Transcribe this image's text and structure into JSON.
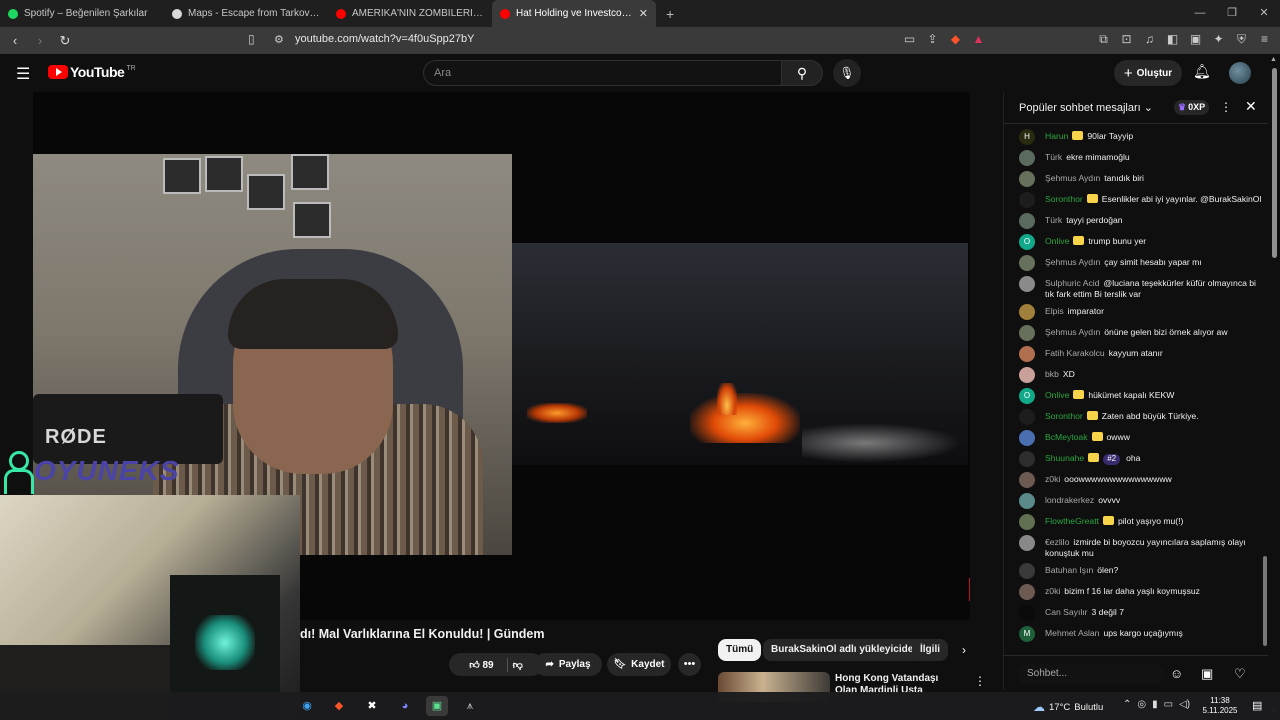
{
  "browser": {
    "tabs": [
      {
        "title": "Spotify – Beğenilen Şarkılar",
        "favicon_color": "#1ed760",
        "active": false
      },
      {
        "title": "Maps - Escape from Tarkov - Tarkov...",
        "favicon_color": "#d9d9d9",
        "active": false
      },
      {
        "title": "AMERİKA'NIN ZOMBİLERİ (BÖYLE Bİ...",
        "favicon_color": "#ff0000",
        "active": false
      },
      {
        "title": "Hat Holding ve Investco Hold...",
        "favicon_color": "#ff0000",
        "active": true
      }
    ],
    "url": "youtube.com/watch?v=4f0uSpp27bY"
  },
  "masthead": {
    "logo_text": "YouTube",
    "country_code": "TR",
    "search_placeholder": "Ara",
    "create_label": "Oluştur"
  },
  "video": {
    "title": "dı! Mal Varlıklarına El Konuldu! | Gündem",
    "like_count": "89",
    "share_label": "Paylaş",
    "save_label": "Kaydet",
    "mic_brand": "RØDE",
    "overlay_logo": "OYUNEKS"
  },
  "related": {
    "chips": [
      "Tümü",
      "BurakSakinOl adlı yükleyiciden",
      "İlgili"
    ],
    "first_video_title": "Hong Kong Vatandaşı Olan Mardinli Usta Anlatıyor ve..."
  },
  "chat": {
    "header_title": "Popüler sohbet mesajları",
    "xp_label": "0XP",
    "input_placeholder": "Sohbet...",
    "messages": [
      {
        "author": "Harun",
        "text": "90lar Tayyip",
        "member": true,
        "avatar_color": "#2a2a10",
        "avatar_letter": "H"
      },
      {
        "author": "Türk",
        "text": "ekre mimamoğlu",
        "member": false,
        "avatar_color": "#5b6a5f",
        "avatar_letter": ""
      },
      {
        "author": "Şehmus Aydın",
        "text": "tanıdık biri",
        "member": false,
        "avatar_color": "#66705a",
        "avatar_letter": ""
      },
      {
        "author": "Soronthor",
        "text": "Esenlikler abi iyi yayınlar. @BurakSakinOl",
        "member": true,
        "avatar_color": "#1d1d1d",
        "avatar_letter": ""
      },
      {
        "author": "Türk",
        "text": "tayyi perdoğan",
        "member": false,
        "avatar_color": "#5b6a5f",
        "avatar_letter": ""
      },
      {
        "author": "Onlive",
        "text": "trump bunu yer",
        "member": true,
        "avatar_color": "#12a88a",
        "avatar_letter": "O"
      },
      {
        "author": "Şehmus Aydın",
        "text": "çay simit hesabı yapar mı",
        "member": false,
        "avatar_color": "#66705a",
        "avatar_letter": ""
      },
      {
        "author": "Sulphuric Acid",
        "text": "@luciana teşekkürler küfür olmayınca bi tık fark ettim Bi terslik var",
        "member": false,
        "avatar_color": "#8a8a8a",
        "avatar_letter": ""
      },
      {
        "author": "Elpis",
        "text": "imparator",
        "member": false,
        "avatar_color": "#a0803a",
        "avatar_letter": ""
      },
      {
        "author": "Şehmus Aydın",
        "text": "önüne gelen bizi örnek alıyor aw",
        "member": false,
        "avatar_color": "#66705a",
        "avatar_letter": ""
      },
      {
        "author": "Fatih Karakolcu",
        "text": "kayyum atanır",
        "member": false,
        "avatar_color": "#b07050",
        "avatar_letter": ""
      },
      {
        "author": "bkb",
        "text": "XD",
        "member": false,
        "avatar_color": "#c9a19a",
        "avatar_letter": ""
      },
      {
        "author": "Onlive",
        "text": "hükümet kapalı KEKW",
        "member": true,
        "avatar_color": "#12a88a",
        "avatar_letter": "O"
      },
      {
        "author": "Soronthor",
        "text": "Zaten abd büyük Türkiye.",
        "member": true,
        "avatar_color": "#1d1d1d",
        "avatar_letter": ""
      },
      {
        "author": "BcMeytoak",
        "text": "owww",
        "member": true,
        "avatar_color": "#4a6fb0",
        "avatar_letter": ""
      },
      {
        "author": "Shuunahe",
        "text": "oha",
        "member": true,
        "avatar_color": "#2d2d2d",
        "avatar_letter": "",
        "rank": "#2"
      },
      {
        "author": "z0ki",
        "text": "ooowwwwwwwwwwwwwww",
        "member": false,
        "avatar_color": "#6d5a50",
        "avatar_letter": ""
      },
      {
        "author": "londrakerkez",
        "text": "ovvvv",
        "member": false,
        "avatar_color": "#5a8a8a",
        "avatar_letter": ""
      },
      {
        "author": "FlowtheGreatt",
        "text": "pilot yaşıyo mu(!)",
        "member": true,
        "avatar_color": "#607050",
        "avatar_letter": ""
      },
      {
        "author": "€ezlilo",
        "text": "izmirde bi boyozcu yayıncılara saplamış olayı konuştuk mu",
        "member": false,
        "avatar_color": "#888888",
        "avatar_letter": ""
      },
      {
        "author": "Batuhan Işın",
        "text": "ölen?",
        "member": false,
        "avatar_color": "#3a3a3a",
        "avatar_letter": ""
      },
      {
        "author": "z0ki",
        "text": "bizim f 16 lar daha yaşlı koymuşsuz",
        "member": false,
        "avatar_color": "#6d5a50",
        "avatar_letter": ""
      },
      {
        "author": "Can Sayılır",
        "text": "3 değil 7",
        "member": false,
        "avatar_color": "#0a0a0a",
        "avatar_letter": ""
      },
      {
        "author": "Mehmet Aslan",
        "text": "ups kargo uçağıymış",
        "member": false,
        "avatar_color": "#1f5f3a",
        "avatar_letter": "M"
      }
    ]
  },
  "taskbar": {
    "weather_temp": "17°C",
    "weather_text": "Bulutlu",
    "time": "11:38",
    "date": "5.11.2025"
  }
}
